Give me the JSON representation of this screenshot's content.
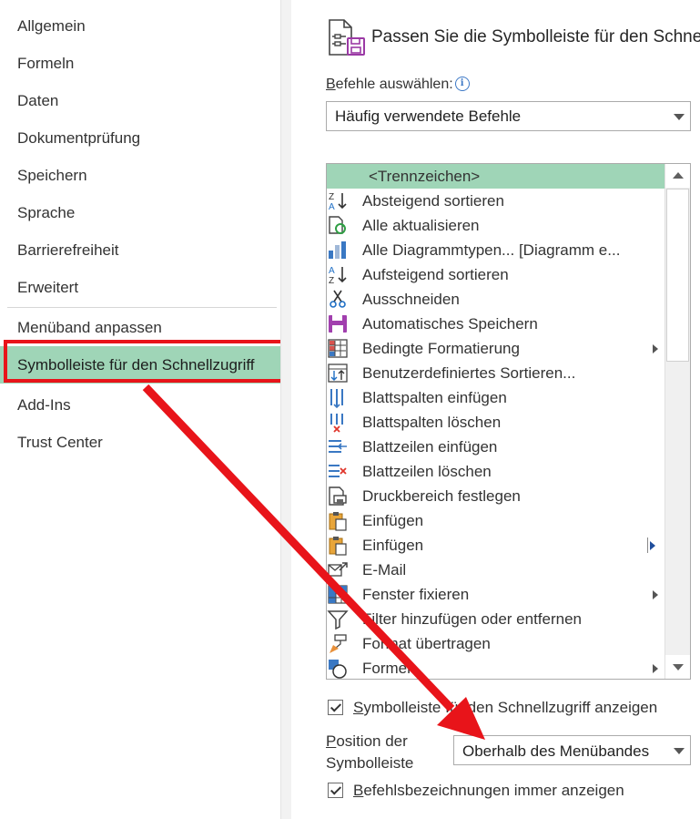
{
  "nav": {
    "items": [
      {
        "label": "Allgemein"
      },
      {
        "label": "Formeln"
      },
      {
        "label": "Daten"
      },
      {
        "label": "Dokumentprüfung"
      },
      {
        "label": "Speichern"
      },
      {
        "label": "Sprache"
      },
      {
        "label": "Barrierefreiheit"
      },
      {
        "label": "Erweitert"
      },
      {
        "label": "Menüband anpassen"
      },
      {
        "label": "Symbolleiste für den Schnellzugriff",
        "selected": true
      },
      {
        "label": "Add-Ins"
      },
      {
        "label": "Trust Center"
      }
    ]
  },
  "header": {
    "title": "Passen Sie die Symbolleiste für den Schne",
    "icon": "quick-access-customize-icon"
  },
  "commands": {
    "label_first": "B",
    "label_rest": "efehle auswählen:",
    "info_icon": "i",
    "selected": "Häufig verwendete Befehle",
    "items": [
      {
        "label": "<Trennzeichen>",
        "icon": "separator",
        "separator": true
      },
      {
        "label": "Absteigend sortieren",
        "icon": "sort-descending-icon"
      },
      {
        "label": "Alle aktualisieren",
        "icon": "refresh-all-icon"
      },
      {
        "label": "Alle Diagrammtypen... [Diagramm e...",
        "icon": "chart-types-icon"
      },
      {
        "label": "Aufsteigend sortieren",
        "icon": "sort-ascending-icon"
      },
      {
        "label": "Ausschneiden",
        "icon": "scissors-icon"
      },
      {
        "label": "Automatisches Speichern",
        "icon": "autosave-icon"
      },
      {
        "label": "Bedingte Formatierung",
        "icon": "conditional-format-icon",
        "submenu": true
      },
      {
        "label": "Benutzerdefiniertes Sortieren...",
        "icon": "custom-sort-icon"
      },
      {
        "label": "Blattspalten einfügen",
        "icon": "insert-columns-icon"
      },
      {
        "label": "Blattspalten löschen",
        "icon": "delete-columns-icon"
      },
      {
        "label": "Blattzeilen einfügen",
        "icon": "insert-rows-icon"
      },
      {
        "label": "Blattzeilen löschen",
        "icon": "delete-rows-icon"
      },
      {
        "label": "Druckbereich festlegen",
        "icon": "print-area-icon"
      },
      {
        "label": "Einfügen",
        "icon": "paste-icon"
      },
      {
        "label": "Einfügen",
        "icon": "paste-icon",
        "splitmenu": true
      },
      {
        "label": "E-Mail",
        "icon": "email-icon"
      },
      {
        "label": "Fenster fixieren",
        "icon": "freeze-panes-icon",
        "submenu": true
      },
      {
        "label": "Filter hinzufügen oder entfernen",
        "icon": "filter-icon"
      },
      {
        "label": "Format übertragen",
        "icon": "format-painter-icon"
      },
      {
        "label": "Formen",
        "icon": "shapes-icon",
        "submenu": true
      }
    ]
  },
  "options": {
    "show_qat": {
      "prefix": "S",
      "rest": "ymbolleiste für den Schnellzugriff anzeigen",
      "checked": true
    },
    "position_label_first": "P",
    "position_label_rest": "osition der",
    "position_label_line2": "Symbolleiste",
    "position_value": "Oberhalb des Menübandes",
    "always_labels": {
      "prefix": "B",
      "rest": "efehlsbezeichnungen immer anzeigen",
      "checked": true
    }
  },
  "colors": {
    "selection": "#9fd5b7",
    "annotation_red": "#e8141a"
  }
}
